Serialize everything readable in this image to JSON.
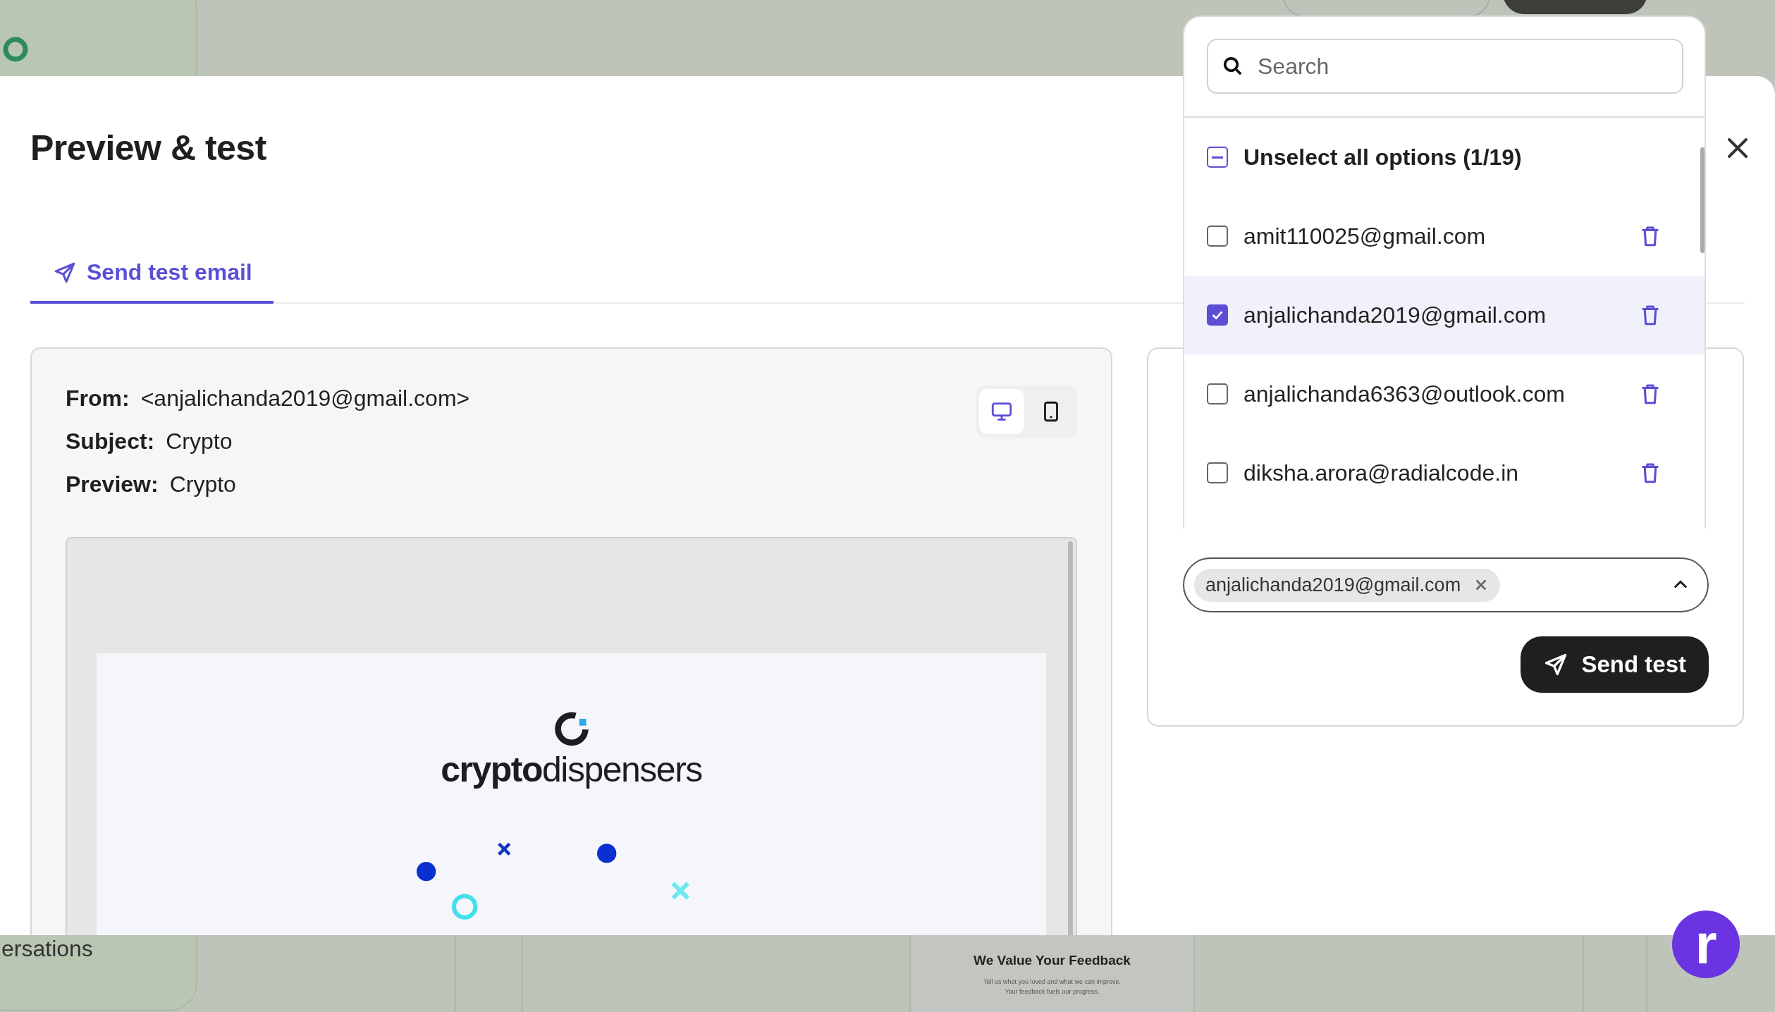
{
  "background": {
    "sidebar_text": "ersations",
    "feedback_card": {
      "title": "We Value Your Feedback",
      "body_lines": [
        "Tell us what you loved and what we can improve.",
        "Your feedback fuels our progress."
      ]
    },
    "launcher_label": "r"
  },
  "modal": {
    "title": "Preview & test",
    "tabs": [
      {
        "label": "Send test email",
        "selected": true
      }
    ],
    "preview": {
      "fields": [
        {
          "label": "From:",
          "value": "<anjalichanda2019@gmail.com>"
        },
        {
          "label": "Subject:",
          "value": "Crypto"
        },
        {
          "label": "Preview:",
          "value": "Crypto"
        }
      ],
      "devices": [
        {
          "kind": "desktop",
          "selected": true
        },
        {
          "kind": "mobile",
          "selected": false
        }
      ],
      "email": {
        "logo_text": "**crypto**dispensers"
      }
    },
    "recipients": {
      "dropdown": {
        "search": {
          "placeholder": "Search"
        },
        "select_all": {
          "label": "Unselect all options (1/19)",
          "indeterminate": true
        },
        "options": [
          {
            "email": "amit110025@gmail.com",
            "checked": false,
            "selected": false
          },
          {
            "email": "anjalichanda2019@gmail.com",
            "checked": true,
            "selected": true
          },
          {
            "email": "anjalichanda6363@outlook.com",
            "checked": false,
            "selected": false
          },
          {
            "email": "diksha.arora@radialcode.in",
            "checked": false,
            "selected": false
          }
        ]
      },
      "chips": [
        {
          "label": "anjalichanda2019@gmail.com"
        }
      ],
      "expanded": true,
      "send_button": "Send test"
    }
  }
}
